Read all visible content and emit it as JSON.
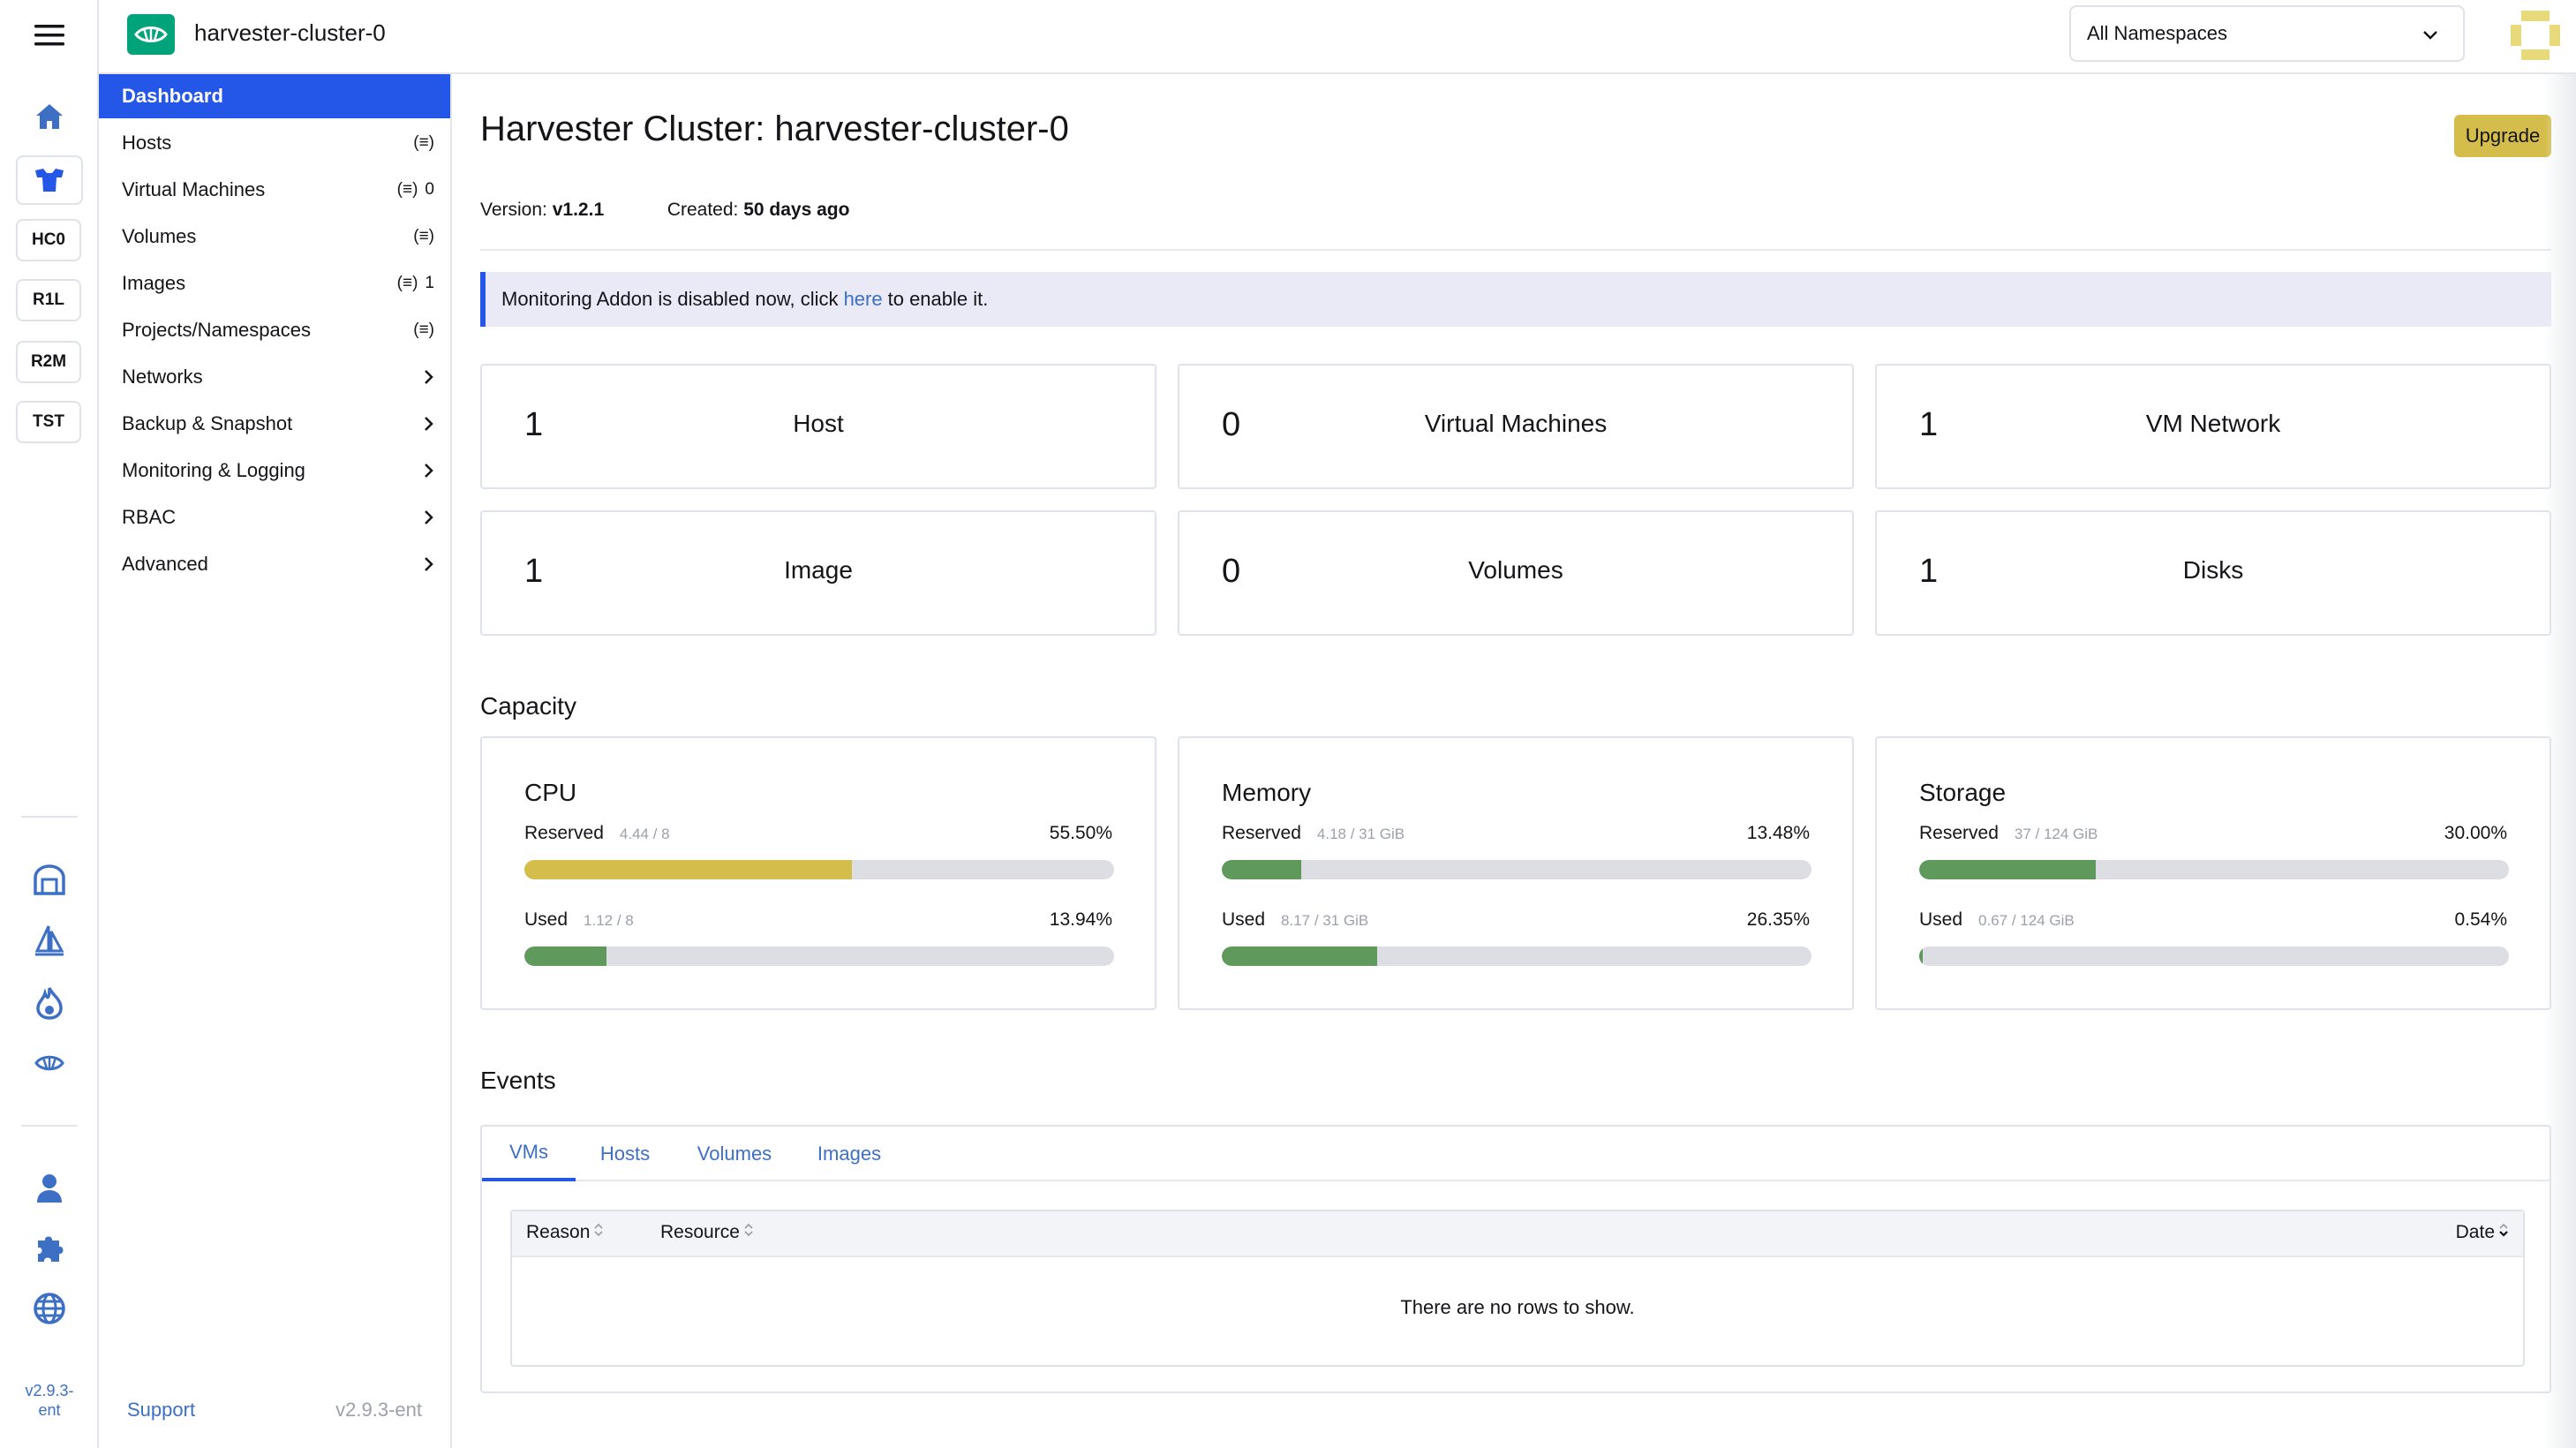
{
  "header": {
    "cluster_name": "harvester-cluster-0",
    "namespace_select": "All Namespaces"
  },
  "rail": {
    "pills": [
      "HC0",
      "R1L",
      "R2M",
      "TST"
    ],
    "version_line1": "v2.9.3-",
    "version_line2": "ent"
  },
  "sidenav": {
    "items": [
      {
        "label": "Dashboard",
        "active": true
      },
      {
        "label": "Hosts",
        "count": ""
      },
      {
        "label": "Virtual Machines",
        "count": "0"
      },
      {
        "label": "Volumes",
        "count": ""
      },
      {
        "label": "Images",
        "count": "1"
      },
      {
        "label": "Projects/Namespaces",
        "count": ""
      },
      {
        "label": "Networks"
      },
      {
        "label": "Backup & Snapshot"
      },
      {
        "label": "Monitoring & Logging"
      },
      {
        "label": "RBAC"
      },
      {
        "label": "Advanced"
      }
    ],
    "support": "Support",
    "version": "v2.9.3-ent"
  },
  "main": {
    "title": "Harvester Cluster: harvester-cluster-0",
    "upgrade": "Upgrade",
    "version_label": "Version:",
    "version_value": "v1.2.1",
    "created_label": "Created:",
    "created_value": "50 days ago",
    "banner_pre": "Monitoring Addon is disabled now, click",
    "banner_link": "here",
    "banner_post": "to enable it.",
    "stats": [
      {
        "num": "1",
        "label": "Host"
      },
      {
        "num": "0",
        "label": "Virtual Machines"
      },
      {
        "num": "1",
        "label": "VM Network"
      },
      {
        "num": "1",
        "label": "Image"
      },
      {
        "num": "0",
        "label": "Volumes"
      },
      {
        "num": "1",
        "label": "Disks"
      }
    ],
    "capacity_title": "Capacity",
    "capacity": [
      {
        "title": "CPU",
        "reserved": {
          "label": "Reserved",
          "sub": "4.44 / 8",
          "pct": "55.50%",
          "fraction": 0.555,
          "color": "#d4bd4a"
        },
        "used": {
          "label": "Used",
          "sub": "1.12 / 8",
          "pct": "13.94%",
          "fraction": 0.1394,
          "color": "#5f9a5c"
        }
      },
      {
        "title": "Memory",
        "reserved": {
          "label": "Reserved",
          "sub": "4.18 / 31 GiB",
          "pct": "13.48%",
          "fraction": 0.1348,
          "color": "#5f9a5c"
        },
        "used": {
          "label": "Used",
          "sub": "8.17 / 31 GiB",
          "pct": "26.35%",
          "fraction": 0.2635,
          "color": "#5f9a5c"
        }
      },
      {
        "title": "Storage",
        "reserved": {
          "label": "Reserved",
          "sub": "37 / 124 GiB",
          "pct": "30.00%",
          "fraction": 0.3,
          "color": "#5f9a5c"
        },
        "used": {
          "label": "Used",
          "sub": "0.67 / 124 GiB",
          "pct": "0.54%",
          "fraction": 0.0054,
          "color": "#5f9a5c"
        }
      }
    ],
    "events_title": "Events",
    "event_tabs": [
      "VMs",
      "Hosts",
      "Volumes",
      "Images"
    ],
    "table_headers": {
      "reason": "Reason",
      "resource": "Resource",
      "date": "Date"
    },
    "empty_text": "There are no rows to show."
  },
  "colors": {
    "accent": "#2456e8",
    "link": "#3d6fc4",
    "brand": "#00a37a",
    "upgrade": "#d4bd4a",
    "bar_green": "#5f9a5c",
    "bar_track": "#dcdee4"
  }
}
